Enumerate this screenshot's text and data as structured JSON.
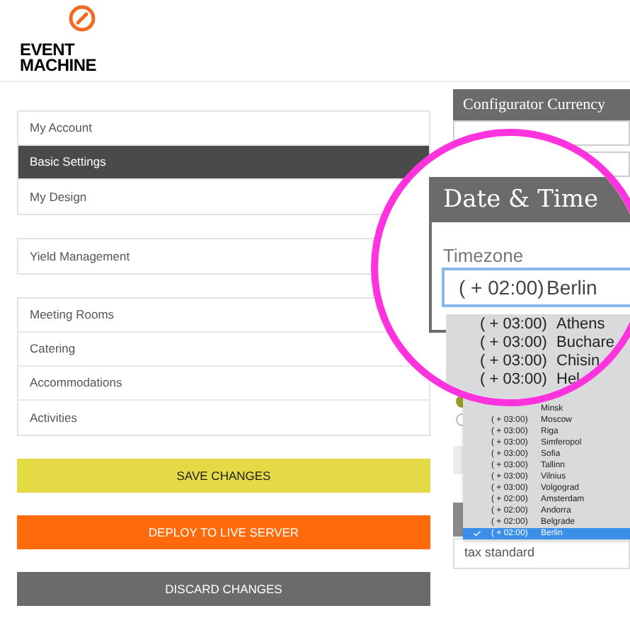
{
  "logo": {
    "lines": [
      "EVENT",
      "MACHINE"
    ]
  },
  "menu_groups": [
    [
      {
        "label": "My Account",
        "selected": false
      },
      {
        "label": "Basic Settings",
        "selected": true
      },
      {
        "label": "My Design",
        "selected": false
      }
    ],
    [
      {
        "label": "Yield Management",
        "selected": false
      }
    ],
    [
      {
        "label": "Meeting Rooms",
        "selected": false
      },
      {
        "label": "Catering",
        "selected": false
      },
      {
        "label": "Accommodations",
        "selected": false
      },
      {
        "label": "Activities",
        "selected": false
      }
    ]
  ],
  "buttons": [
    {
      "label": "SAVE CHANGES",
      "kind": "save"
    },
    {
      "label": "DEPLOY TO LIVE SERVER",
      "kind": "deploy"
    },
    {
      "label": "DISCARD CHANGES",
      "kind": "discard"
    }
  ],
  "right_panel": {
    "currency_title": "Configurator Currency",
    "radios": [
      {
        "selected": true
      },
      {
        "selected": false
      }
    ],
    "tax_field": {
      "value": "tax standard"
    }
  },
  "timezone_list": [
    {
      "city": "Minsk",
      "selected": false
    },
    {
      "offset": "( + 03:00)",
      "city": "Moscow",
      "selected": false
    },
    {
      "offset": "( + 03:00)",
      "city": "Riga",
      "selected": false
    },
    {
      "offset": "( + 03:00)",
      "city": "Simferopol",
      "selected": false
    },
    {
      "offset": "( + 03:00)",
      "city": "Sofia",
      "selected": false
    },
    {
      "offset": "( + 03:00)",
      "city": "Tallinn",
      "selected": false
    },
    {
      "offset": "( + 03:00)",
      "city": "Vilnius",
      "selected": false
    },
    {
      "offset": "( + 03:00)",
      "city": "Volgograd",
      "selected": false
    },
    {
      "offset": "( + 02:00)",
      "city": "Amsterdam",
      "selected": false
    },
    {
      "offset": "( + 02:00)",
      "city": "Andorra",
      "selected": false
    },
    {
      "offset": "( + 02:00)",
      "city": "Belgrade",
      "selected": false
    },
    {
      "offset": "( + 02:00)",
      "city": "Berlin",
      "selected": true
    }
  ],
  "magnifier": {
    "panel_title": "Date & Time",
    "field_label": "Timezone",
    "field_value": {
      "offset": "( + 02:00)",
      "city": "Berlin"
    },
    "list": [
      {
        "offset": "( + 03:00)",
        "city": "Athens"
      },
      {
        "offset": "( + 03:00)",
        "city": "Buchare"
      },
      {
        "offset": "( + 03:00)",
        "city": "Chisin"
      },
      {
        "offset": "( + 03:00)",
        "city": "Hel"
      }
    ]
  }
}
